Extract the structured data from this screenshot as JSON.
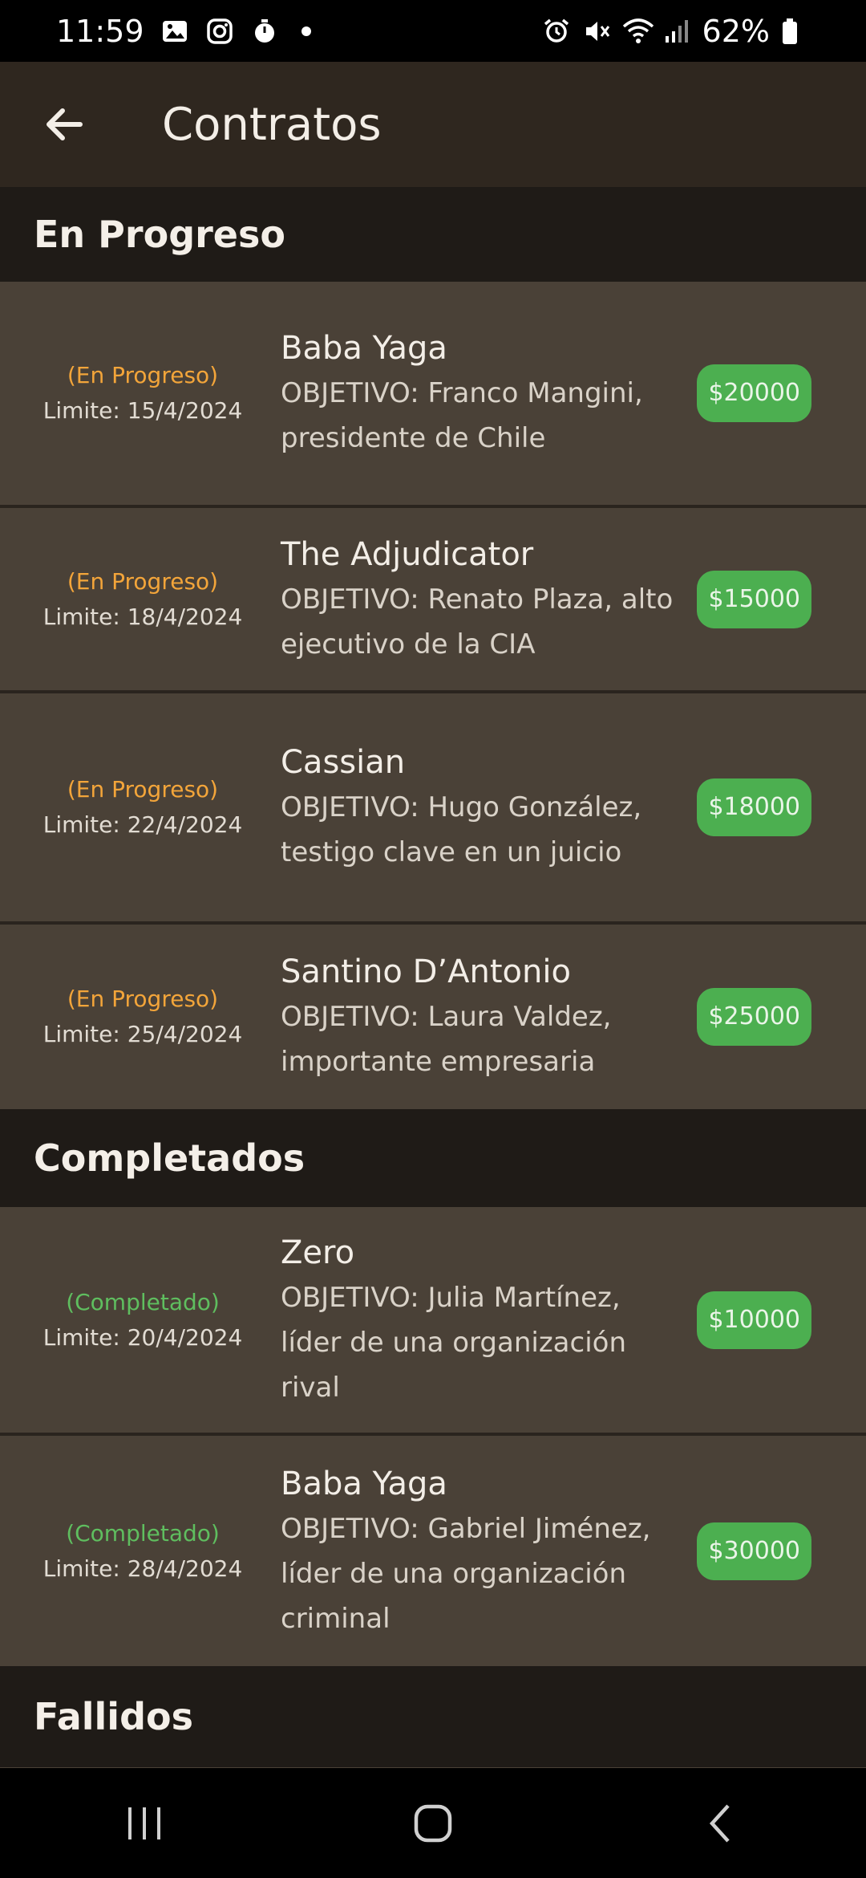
{
  "status_bar": {
    "time": "11:59",
    "battery": "62%"
  },
  "app_bar": {
    "title": "Contratos"
  },
  "sections": {
    "in_progress": {
      "title": "En Progreso",
      "rows": [
        {
          "status": "(En Progreso)",
          "deadline": "Limite: 15/4/2024",
          "name": "Baba Yaga",
          "objective": "OBJETIVO:  Franco Mangini, presidente de Chile",
          "price": "$20000"
        },
        {
          "status": "(En Progreso)",
          "deadline": "Limite: 18/4/2024",
          "name": "The Adjudicator",
          "objective": "OBJETIVO:  Renato Plaza, alto ejecutivo de la CIA",
          "price": "$15000"
        },
        {
          "status": "(En Progreso)",
          "deadline": "Limite: 22/4/2024",
          "name": "Cassian",
          "objective": "OBJETIVO:  Hugo González, testigo clave en un juicio",
          "price": "$18000"
        },
        {
          "status": "(En Progreso)",
          "deadline": "Limite: 25/4/2024",
          "name": "Santino D’Antonio",
          "objective": "OBJETIVO:  Laura Valdez, importante empresaria",
          "price": "$25000"
        }
      ]
    },
    "completed": {
      "title": "Completados",
      "rows": [
        {
          "status": "(Completado)",
          "deadline": "Limite: 20/4/2024",
          "name": "Zero",
          "objective": "OBJETIVO:  Julia Martínez, líder de una organización rival",
          "price": "$10000"
        },
        {
          "status": "(Completado)",
          "deadline": "Limite: 28/4/2024",
          "name": "Baba Yaga",
          "objective": "OBJETIVO:  Gabriel Jiménez, líder de una organización criminal",
          "price": "$30000"
        }
      ]
    },
    "failed": {
      "title": "Fallidos"
    }
  },
  "colors": {
    "app_bar": "#2f271f",
    "row_bg": "#4a4137",
    "section_bg": "#1f1b17",
    "progress": "#f3a53a",
    "completed": "#5fbe5f",
    "price_bg": "#4caf50"
  },
  "icons": [
    "image-icon",
    "instagram-icon",
    "timer-icon",
    "alarm-icon",
    "mute-icon",
    "wifi-icon",
    "signal-icon",
    "battery-icon",
    "back-arrow-icon",
    "recent-apps-icon",
    "home-icon",
    "nav-back-icon"
  ]
}
